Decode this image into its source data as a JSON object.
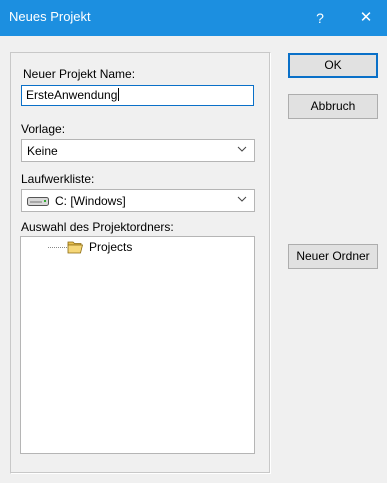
{
  "window": {
    "title": "Neues Projekt",
    "help_label": "?",
    "close_label": "✕",
    "title_color": "#1c8fe0"
  },
  "form": {
    "name_label": "Neuer Projekt Name:",
    "name_value": "ErsteAnwendung",
    "template_label": "Vorlage:",
    "template_value": "Keine",
    "drive_label": "Laufwerkliste:",
    "drive_value": "C: [Windows]",
    "drive_icon": "drive-icon",
    "folder_label": "Auswahl des Projektordners:",
    "folder_tree": [
      {
        "label": "Projects",
        "icon": "folder-open-icon"
      }
    ]
  },
  "buttons": {
    "ok": "OK",
    "cancel": "Abbruch",
    "new_folder": "Neuer Ordner"
  }
}
